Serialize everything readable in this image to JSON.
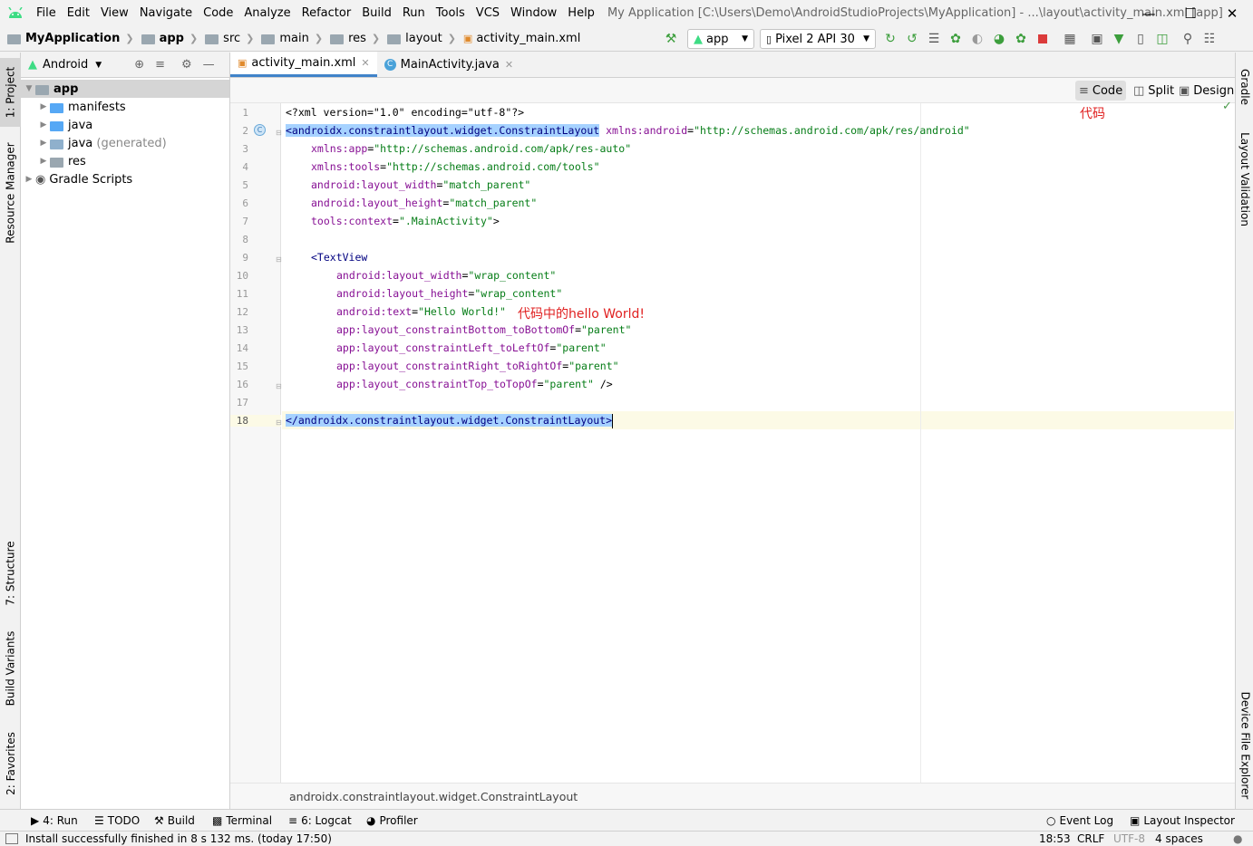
{
  "menubar": {
    "items": [
      "File",
      "Edit",
      "View",
      "Navigate",
      "Code",
      "Analyze",
      "Refactor",
      "Build",
      "Run",
      "Tools",
      "VCS",
      "Window",
      "Help"
    ],
    "window_title": "My Application [C:\\Users\\Demo\\AndroidStudioProjects\\MyApplication] - ...\\layout\\activity_main.xml [app]"
  },
  "navbar": {
    "crumbs": [
      "MyApplication",
      "app",
      "src",
      "main",
      "res",
      "layout",
      "activity_main.xml"
    ],
    "run_config": "app",
    "device": "Pixel 2 API 30"
  },
  "left_tabs": {
    "project": "1: Project",
    "resource_manager": "Resource Manager",
    "structure": "7: Structure",
    "build_variants": "Build Variants",
    "favorites": "2: Favorites"
  },
  "right_tabs": {
    "gradle": "Gradle",
    "layout_validation": "Layout Validation",
    "device_file_explorer": "Device File Explorer"
  },
  "project_panel": {
    "view_mode": "Android",
    "tree": [
      {
        "label": "app",
        "level": 0,
        "expanded": true
      },
      {
        "label": "manifests",
        "level": 1
      },
      {
        "label": "java",
        "level": 1
      },
      {
        "label": "java",
        "suffix": "(generated)",
        "level": 1
      },
      {
        "label": "res",
        "level": 1
      },
      {
        "label": "Gradle Scripts",
        "level": 0
      }
    ]
  },
  "editor": {
    "tabs": [
      {
        "label": "activity_main.xml",
        "active": true
      },
      {
        "label": "MainActivity.java",
        "active": false
      }
    ],
    "view_modes": [
      "Code",
      "Split",
      "Design"
    ],
    "active_view": "Code",
    "line_numbers": [
      "1",
      "2",
      "3",
      "4",
      "5",
      "6",
      "7",
      "8",
      "9",
      "10",
      "11",
      "12",
      "13",
      "14",
      "15",
      "16",
      "17",
      "18"
    ],
    "code": {
      "l1": "<?xml version=\"1.0\" encoding=\"utf-8\"?>",
      "l2_tag": "<androidx.constraintlayout.widget.ConstraintLayout",
      "l2_attr": "xmlns:android",
      "l2_val": "\"http://schemas.android.com/apk/res/android\"",
      "l3_attr": "xmlns:app",
      "l3_val": "\"http://schemas.android.com/apk/res-auto\"",
      "l4_attr": "xmlns:tools",
      "l4_val": "\"http://schemas.android.com/tools\"",
      "l5_attr": "android:layout_width",
      "l5_val": "\"match_parent\"",
      "l6_attr": "android:layout_height",
      "l6_val": "\"match_parent\"",
      "l7_attr": "tools:context",
      "l7_val": "\".MainActivity\"",
      "l9_tag": "<TextView",
      "l10_attr": "android:layout_width",
      "l10_val": "\"wrap_content\"",
      "l11_attr": "android:layout_height",
      "l11_val": "\"wrap_content\"",
      "l12_attr": "android:text",
      "l12_val": "\"Hello World!\"",
      "l13_attr": "app:layout_constraintBottom_toBottomOf",
      "l13_val": "\"parent\"",
      "l14_attr": "app:layout_constraintLeft_toLeftOf",
      "l14_val": "\"parent\"",
      "l15_attr": "app:layout_constraintRight_toRightOf",
      "l15_val": "\"parent\"",
      "l16_attr": "app:layout_constraintTop_toTopOf",
      "l16_val": "\"parent\"",
      "l18_tag": "</androidx.constraintlayout.widget.ConstraintLayout>"
    },
    "annotations": {
      "code_label": "代码",
      "hello_label": "代码中的hello World!"
    },
    "breadcrumb_path": "androidx.constraintlayout.widget.ConstraintLayout"
  },
  "bottom_tools": {
    "run": "4: Run",
    "todo": "TODO",
    "build": "Build",
    "terminal": "Terminal",
    "logcat": "6: Logcat",
    "profiler": "Profiler",
    "event_log": "Event Log",
    "layout_inspector": "Layout Inspector"
  },
  "status": {
    "message": "Install successfully finished in 8 s 132 ms. (today 17:50)",
    "position": "18:53",
    "line_sep": "CRLF",
    "encoding": "UTF-8",
    "indent": "4 spaces"
  },
  "colors": {
    "accent": "#4083c9",
    "android_green": "#3ddc84",
    "selection": "#a6d2ff",
    "annotation_red": "#e02020"
  }
}
